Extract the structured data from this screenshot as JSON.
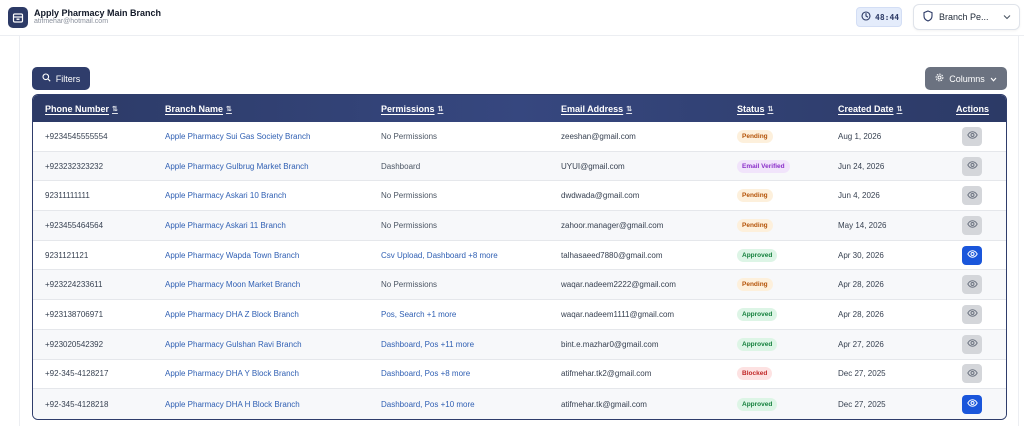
{
  "header": {
    "title": "Apply Pharmacy Main Branch",
    "email": "atifmehar@hotmail.com",
    "timer": "48:44",
    "branch_selector": "Branch Pe..."
  },
  "toolbar": {
    "filters_label": "Filters",
    "columns_label": "Columns"
  },
  "table": {
    "columns": [
      "Phone Number",
      "Branch Name",
      "Permissions",
      "Email Address",
      "Status",
      "Created Date",
      "Actions"
    ],
    "rows": [
      {
        "phone": "+9234545555554",
        "branch": "Apple Pharmacy Sui Gas Society Branch",
        "permissions": "No Permissions",
        "perm_link": false,
        "email": "zeeshan@gmail.com",
        "status": "Pending",
        "date": "Aug 1, 2026",
        "active": false
      },
      {
        "phone": "+923232323232",
        "branch": "Apple Pharmacy Gulbrug Market Branch",
        "permissions": "Dashboard",
        "perm_link": false,
        "email": "UYUI@gmail.com",
        "status": "Email Verified",
        "date": "Jun 24, 2026",
        "active": false
      },
      {
        "phone": "92311111111",
        "branch": "Apple Pharmacy Askari 10 Branch",
        "permissions": "No Permissions",
        "perm_link": false,
        "email": "dwdwada@gmail.com",
        "status": "Pending",
        "date": "Jun 4, 2026",
        "active": false
      },
      {
        "phone": "+923455464564",
        "branch": "Apple Pharmacy Askari 11 Branch",
        "permissions": "No Permissions",
        "perm_link": false,
        "email": "zahoor.manager@gmail.com",
        "status": "Pending",
        "date": "May 14, 2026",
        "active": false
      },
      {
        "phone": "9231121121",
        "branch": "Apple Pharmacy Wapda Town Branch",
        "permissions": "Csv Upload, Dashboard +8 more",
        "perm_link": true,
        "email": "talhasaeed7880@gmail.com",
        "status": "Approved",
        "date": "Apr 30, 2026",
        "active": true
      },
      {
        "phone": "+923224233611",
        "branch": "Apple Pharmacy Moon Market Branch",
        "permissions": "No Permissions",
        "perm_link": false,
        "email": "waqar.nadeem2222@gmail.com",
        "status": "Pending",
        "date": "Apr 28, 2026",
        "active": false
      },
      {
        "phone": "+923138706971",
        "branch": "Apple Pharmacy DHA Z Block Branch",
        "permissions": "Pos, Search +1 more",
        "perm_link": true,
        "email": "waqar.nadeem1111@gmail.com",
        "status": "Approved",
        "date": "Apr 28, 2026",
        "active": false
      },
      {
        "phone": "+923020542392",
        "branch": "Apple Pharmacy Gulshan Ravi Branch",
        "permissions": "Dashboard, Pos +11 more",
        "perm_link": true,
        "email": "bint.e.mazhar0@gmail.com",
        "status": "Approved",
        "date": "Apr 27, 2026",
        "active": false
      },
      {
        "phone": "+92-345-4128217",
        "branch": "Apple Pharmacy DHA Y Block Branch",
        "permissions": "Dashboard, Pos +8 more",
        "perm_link": true,
        "email": "atifmehar.tk2@gmail.com",
        "status": "Blocked",
        "date": "Dec 27, 2025",
        "active": false
      },
      {
        "phone": "+92-345-4128218",
        "branch": "Apple Pharmacy DHA H Block Branch",
        "permissions": "Dashboard, Pos +10 more",
        "perm_link": true,
        "email": "atifmehar.tk@gmail.com",
        "status": "Approved",
        "date": "Dec 27, 2025",
        "active": true
      }
    ]
  },
  "colors": {
    "primary": "#2c3a66",
    "link": "#2f5fb3",
    "action_active": "#1a56db"
  },
  "icons": {
    "app": "store-icon",
    "timer": "clock-icon",
    "branch": "shield-icon",
    "filters": "search-icon",
    "columns": "gear-icon",
    "view": "eye-icon",
    "sort": "sort-icon"
  }
}
